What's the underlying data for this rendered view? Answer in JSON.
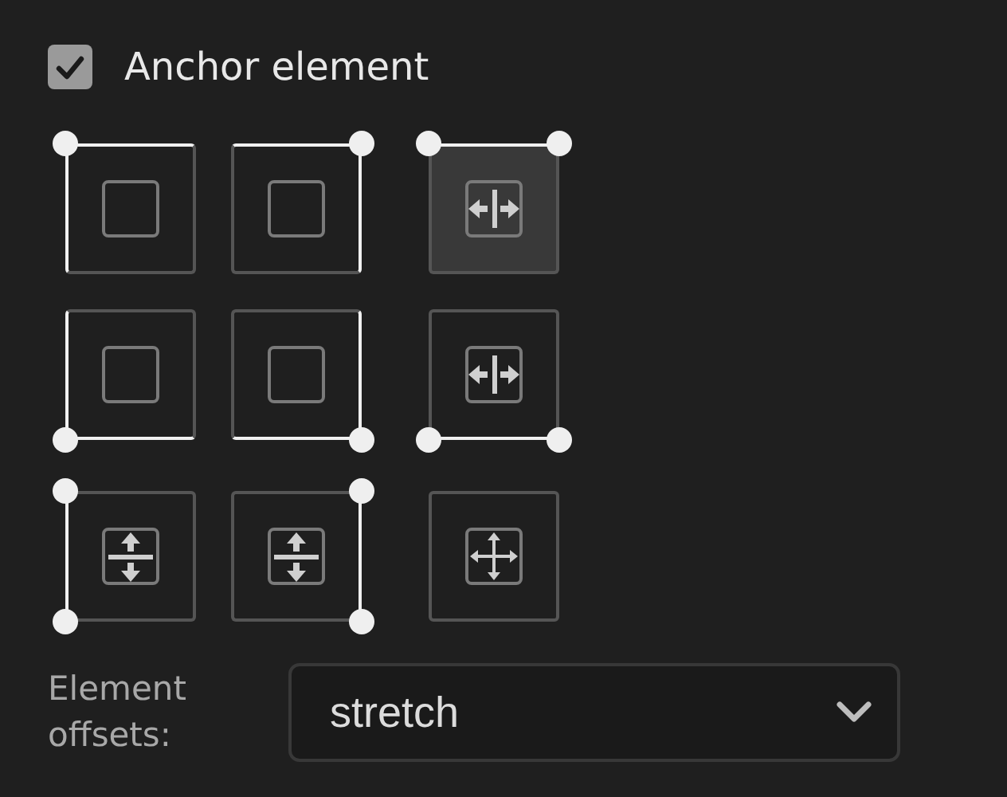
{
  "anchor_checkbox": {
    "label": "Anchor element",
    "checked": true
  },
  "anchors": [
    {
      "kind": "top_left",
      "selected": false
    },
    {
      "kind": "top_right",
      "selected": false
    },
    {
      "kind": "top_stretch",
      "selected": true
    },
    {
      "kind": "bottom_left",
      "selected": false
    },
    {
      "kind": "bottom_right",
      "selected": false
    },
    {
      "kind": "bottom_stretch",
      "selected": false
    },
    {
      "kind": "left_stretch",
      "selected": false
    },
    {
      "kind": "right_stretch",
      "selected": false
    },
    {
      "kind": "full_stretch",
      "selected": false
    }
  ],
  "offsets": {
    "label": "Element offsets:",
    "value": "stretch"
  }
}
